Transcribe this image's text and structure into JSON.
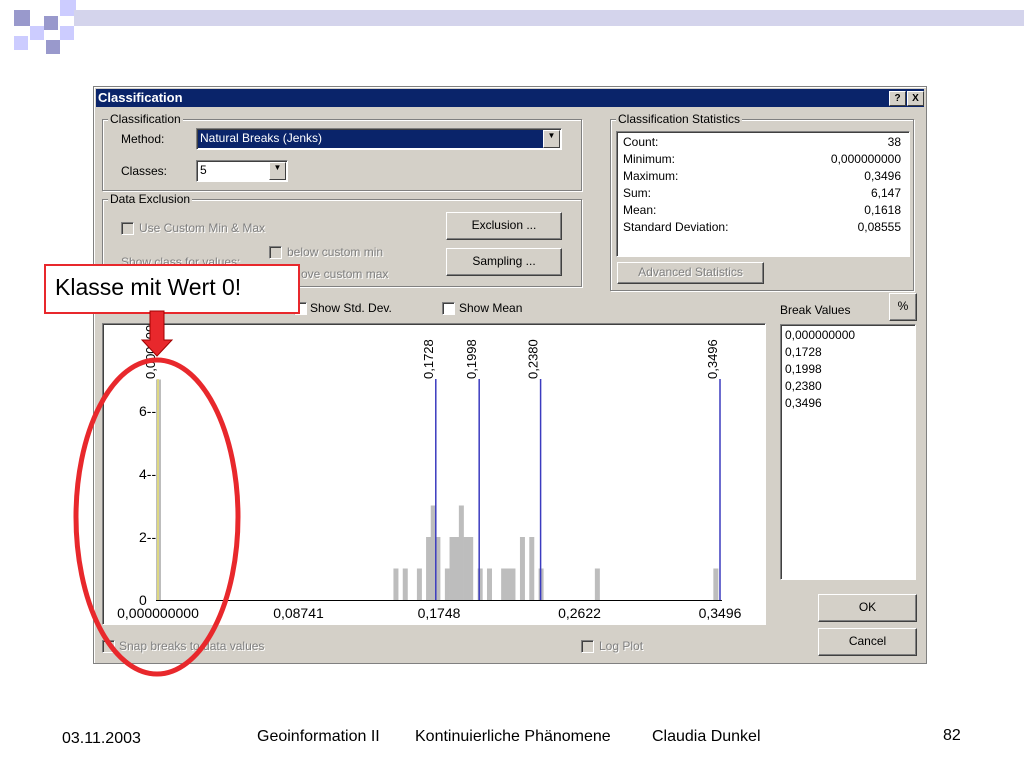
{
  "dialog": {
    "title": "Classification",
    "help_button": "?",
    "close_button": "X"
  },
  "classification_group": {
    "legend": "Classification",
    "method_label": "Method:",
    "method_value": "Natural Breaks (Jenks)",
    "classes_label": "Classes:",
    "classes_value": "5"
  },
  "statistics_group": {
    "legend": "Classification Statistics",
    "rows": [
      {
        "label": "Count:",
        "value": "38"
      },
      {
        "label": "Minimum:",
        "value": "0,000000000"
      },
      {
        "label": "Maximum:",
        "value": "0,3496"
      },
      {
        "label": "Sum:",
        "value": "6,147"
      },
      {
        "label": "Mean:",
        "value": "0,1618"
      },
      {
        "label": "Standard Deviation:",
        "value": "0,08555"
      }
    ],
    "advanced_button": "Advanced Statistics"
  },
  "exclusion_group": {
    "legend": "Data Exclusion",
    "custom_minmax": "Use Custom Min & Max",
    "show_class_for_values": "Show class for values:",
    "below_custom_min": "below custom min",
    "above_custom_max": "ove custom max",
    "exclusion_button": "Exclusion ...",
    "sampling_button": "Sampling ..."
  },
  "options": {
    "show_std_dev": "Show Std. Dev.",
    "show_mean": "Show Mean",
    "snap_breaks": "Snap breaks to data values",
    "log_plot": "Log Plot"
  },
  "break_values": {
    "label": "Break Values",
    "percent_button": "%",
    "items": [
      "0,000000000",
      "0,1728",
      "0,1998",
      "0,2380",
      "0,3496"
    ]
  },
  "buttons": {
    "ok": "OK",
    "cancel": "Cancel"
  },
  "chart_data": {
    "type": "bar",
    "x_ticks": [
      "0,000000000",
      "0,08741",
      "0,1748",
      "0,2622",
      "0,3496"
    ],
    "y_ticks": [
      "0",
      "2--",
      "4--",
      "6--"
    ],
    "xlim": [
      0,
      0.3496
    ],
    "ylim": [
      0,
      7
    ],
    "bins": [
      {
        "x": 0.0,
        "y": 7
      },
      {
        "x": 0.1477,
        "y": 1
      },
      {
        "x": 0.1535,
        "y": 1
      },
      {
        "x": 0.1623,
        "y": 1
      },
      {
        "x": 0.168,
        "y": 2
      },
      {
        "x": 0.1709,
        "y": 3
      },
      {
        "x": 0.1738,
        "y": 2
      },
      {
        "x": 0.1797,
        "y": 1
      },
      {
        "x": 0.1826,
        "y": 2
      },
      {
        "x": 0.1855,
        "y": 2
      },
      {
        "x": 0.1884,
        "y": 3
      },
      {
        "x": 0.1913,
        "y": 2
      },
      {
        "x": 0.1942,
        "y": 2
      },
      {
        "x": 0.2001,
        "y": 1
      },
      {
        "x": 0.2059,
        "y": 1
      },
      {
        "x": 0.2147,
        "y": 1
      },
      {
        "x": 0.2176,
        "y": 1
      },
      {
        "x": 0.2205,
        "y": 1
      },
      {
        "x": 0.2264,
        "y": 2
      },
      {
        "x": 0.2322,
        "y": 2
      },
      {
        "x": 0.238,
        "y": 1
      },
      {
        "x": 0.273,
        "y": 1
      },
      {
        "x": 0.3467,
        "y": 1
      }
    ],
    "breaks": [
      {
        "x": 0.0,
        "label": "0,000000000",
        "color": "#e8e070"
      },
      {
        "x": 0.1728,
        "label": "0,1728",
        "color": "#3b3bbf"
      },
      {
        "x": 0.1998,
        "label": "0,1998",
        "color": "#3b3bbf"
      },
      {
        "x": 0.238,
        "label": "0,2380",
        "color": "#3b3bbf"
      },
      {
        "x": 0.3496,
        "label": "0,3496",
        "color": "#3b3bbf"
      }
    ],
    "bar_color": "#bdbdbd"
  },
  "annotation": {
    "callout_text": "Klasse mit Wert 0!",
    "color": "#e8282c"
  },
  "footer": {
    "date": "03.11.2003",
    "course": "Geoinformation II",
    "topic": "Kontinuierliche Phänomene",
    "author": "Claudia Dunkel",
    "page": "82"
  }
}
